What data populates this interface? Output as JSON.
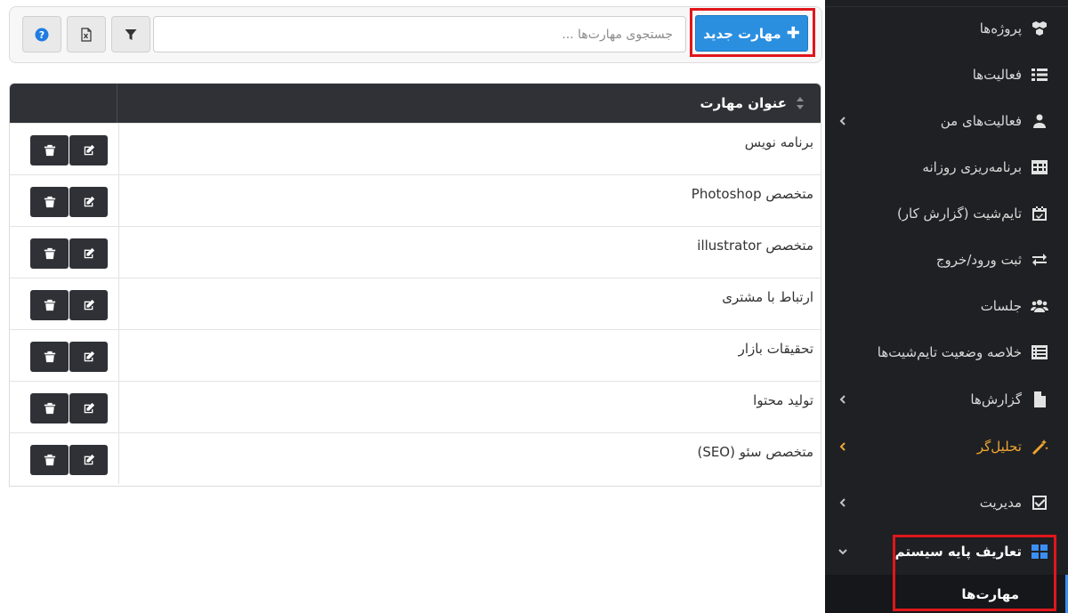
{
  "toolbar": {
    "new_label": "مهارت جدید",
    "search_placeholder": "جستجوی مهارت‌ها ...",
    "icons": [
      "filter-icon",
      "excel-icon",
      "help-icon"
    ]
  },
  "table": {
    "header_title": "عنوان مهارت",
    "rows": [
      "برنامه نویس",
      "متخصص Photoshop",
      "متخصص illustrator",
      "ارتباط با مشتری",
      "تحقیقات بازار",
      "تولید محتوا",
      "متخصص سئو (SEO)"
    ]
  },
  "sidebar": {
    "items": [
      {
        "label": "پروژه‌ها",
        "icon": "cubes-icon",
        "chevron": false
      },
      {
        "label": "فعالیت‌ها",
        "icon": "list-icon",
        "chevron": false
      },
      {
        "label": "فعالیت‌های من",
        "icon": "user-icon",
        "chevron": true
      },
      {
        "label": "برنامه‌ریزی روزانه",
        "icon": "table-icon",
        "chevron": false
      },
      {
        "label": "تایم‌شیت (گزارش کار)",
        "icon": "calendar-check-icon",
        "chevron": false
      },
      {
        "label": "ثبت ورود/خروج",
        "icon": "exchange-icon",
        "chevron": false
      },
      {
        "label": "جلسات",
        "icon": "users-icon",
        "chevron": false
      },
      {
        "label": "خلاصه وضعیت تایم‌شیت‌ها",
        "icon": "list-alt-icon",
        "chevron": false
      },
      {
        "label": "گزارش‌ها",
        "icon": "file-icon",
        "chevron": true
      },
      {
        "label": "تحلیل‌گر",
        "icon": "magic-icon",
        "chevron": true
      },
      {
        "label": "مدیریت",
        "icon": "check-square-icon",
        "chevron": true
      },
      {
        "label": "تعاریف پایه سیستم",
        "icon": "windows-icon",
        "chevron": true
      }
    ],
    "sub_item": "مهارت‌ها",
    "accent_color": "#f0a632",
    "active_color": "#3c8ff2"
  }
}
